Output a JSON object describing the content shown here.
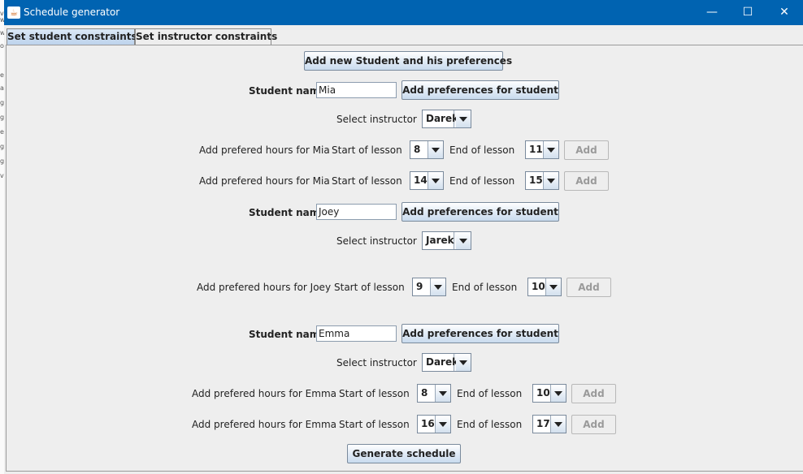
{
  "window": {
    "title": "Schedule generator"
  },
  "icons": {
    "app": "java-icon",
    "minimize": "minimize-icon",
    "maximize": "maximize-icon",
    "close": "close-icon"
  },
  "colors": {
    "titlebar": "#0063b1",
    "panel": "#eeeeee",
    "button_gradient_end": "#c9dbee"
  },
  "tabs": [
    {
      "label": "Set student constraints",
      "active": true
    },
    {
      "label": "Set instructor constraints",
      "active": false
    }
  ],
  "add_student_button": "Add new Student and his preferences",
  "students": [
    {
      "name_label": "Student name",
      "name_value": "Mia",
      "add_pref_button": "Add preferences for student",
      "instructor_label": "Select instructor",
      "instructor_value": "Darek",
      "preferences": [
        {
          "label": "Add prefered hours for Mia",
          "start_label": "Start of lesson",
          "start_value": "8",
          "end_label": "End of lesson",
          "end_value": "11",
          "add_label": "Add"
        },
        {
          "label": "Add prefered hours for Mia",
          "start_label": "Start of lesson",
          "start_value": "14",
          "end_label": "End of lesson",
          "end_value": "15",
          "add_label": "Add"
        }
      ]
    },
    {
      "name_label": "Student name",
      "name_value": "Joey",
      "add_pref_button": "Add preferences for student",
      "instructor_label": "Select instructor",
      "instructor_value": "Jarek",
      "preferences": [
        {
          "label": "Add prefered hours for Joey",
          "start_label": "Start of lesson",
          "start_value": "9",
          "end_label": "End of lesson",
          "end_value": "10",
          "add_label": "Add"
        }
      ]
    },
    {
      "name_label": "Student name",
      "name_value": "Emma",
      "add_pref_button": "Add preferences for student",
      "instructor_label": "Select instructor",
      "instructor_value": "Darek",
      "preferences": [
        {
          "label": "Add prefered hours for Emma",
          "start_label": "Start of lesson",
          "start_value": "8",
          "end_label": "End of lesson",
          "end_value": "10",
          "add_label": "Add"
        },
        {
          "label": "Add prefered hours for Emma",
          "start_label": "Start of lesson",
          "start_value": "16",
          "end_label": "End of lesson",
          "end_value": "17",
          "add_label": "Add"
        }
      ]
    }
  ],
  "generate_button": "Generate schedule"
}
